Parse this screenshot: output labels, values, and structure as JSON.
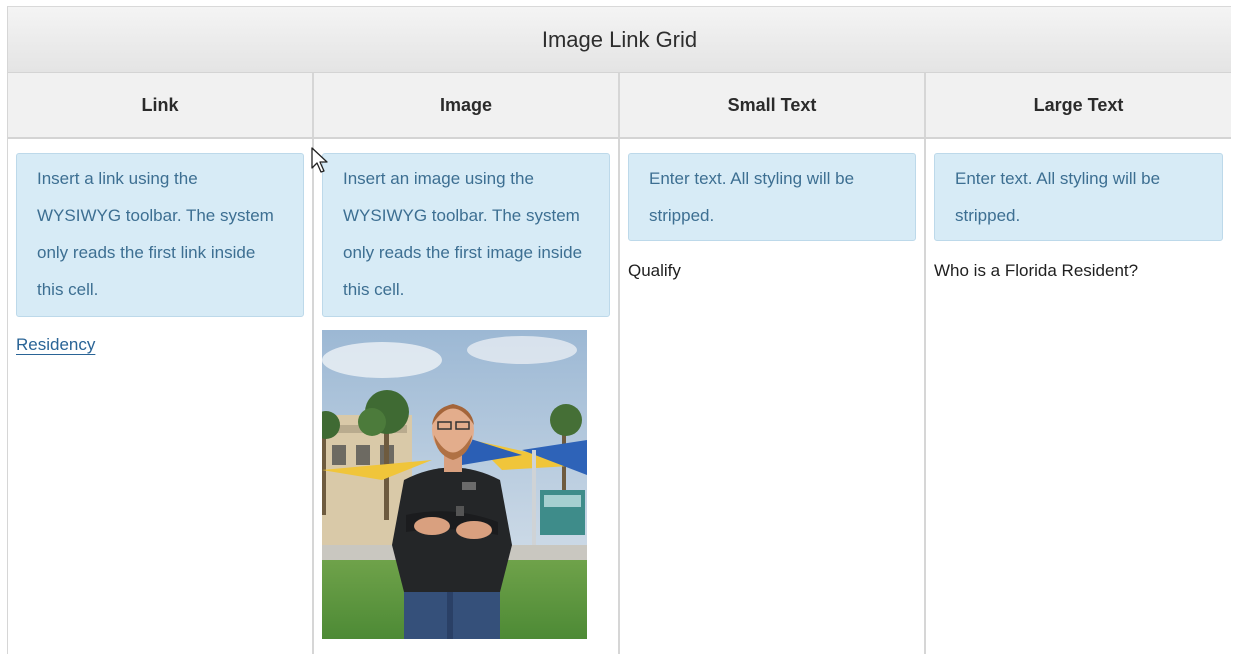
{
  "grid": {
    "title": "Image Link Grid",
    "columns": [
      {
        "header": "Link"
      },
      {
        "header": "Image"
      },
      {
        "header": "Small Text"
      },
      {
        "header": "Large Text"
      }
    ],
    "link_cell": {
      "note": "Insert a link using the WYSIWYG toolbar. The system only reads the first link inside this cell.",
      "value": "Residency"
    },
    "image_cell": {
      "note": "Insert an image using the WYSIWYG toolbar. The system only reads the first image inside this cell.",
      "image_alt": "Photo of a man in a black polo shirt with arms crossed on a campus"
    },
    "small_text_cell": {
      "note": "Enter text. All styling will be stripped.",
      "value": "Qualify"
    },
    "large_text_cell": {
      "note": "Enter text. All styling will be stripped.",
      "value": "Who is a Florida Resident?"
    }
  },
  "colors": {
    "note_bg": "#d7ebf6",
    "note_text": "#3d6f92",
    "link": "#2a6496"
  },
  "icons": {
    "cursor": "mouse-pointer-icon"
  }
}
